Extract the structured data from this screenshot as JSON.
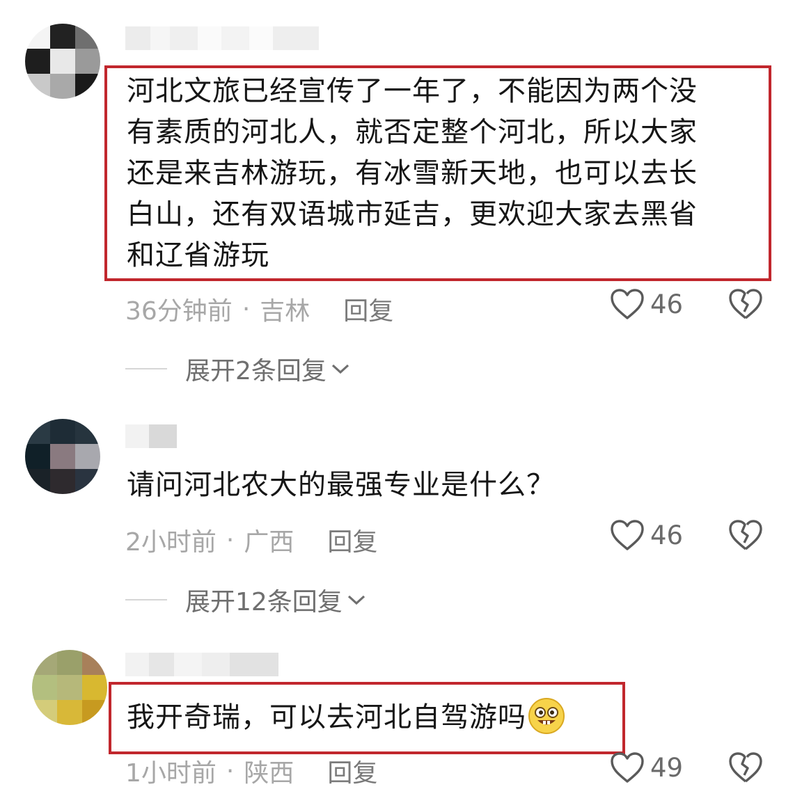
{
  "comments": [
    {
      "text": "河北文旅已经宣传了一年了，不能因为两个没有素质的河北人，就否定整个河北，所以大家还是来吉林游玩，有冰雪新天地，也可以去长白山，还有双语城市延吉，更欢迎大家去黑省和辽省游玩",
      "lines": [
        "河北文旅已经宣传了一年了，不能因为两个没",
        "有素质的河北人，就否定整个河北，所以大家",
        "还是来吉林游玩，有冰雪新天地，也可以去长",
        "白山，还有双语城市延吉，更欢迎大家去黑省",
        "和辽省游玩"
      ],
      "time": "36分钟前",
      "location": "吉林",
      "reply_label": "回复",
      "likes": "46",
      "expand": "展开2条回复",
      "highlighted": true
    },
    {
      "text": "请问河北农大的最强专业是什么？",
      "lines": [
        "请问河北农大的最强专业是什么？"
      ],
      "time": "2小时前",
      "location": "广西",
      "reply_label": "回复",
      "likes": "46",
      "expand": "展开12条回复",
      "highlighted": false
    },
    {
      "text": "我开奇瑞，可以去河北自驾游吗",
      "lines": [
        "我开奇瑞，可以去河北自驾游吗"
      ],
      "emoji": "grinning-emoji",
      "time": "1小时前",
      "location": "陕西",
      "reply_label": "回复",
      "likes": "49",
      "highlighted": true
    }
  ],
  "separator": "·",
  "colors": {
    "highlight_border": "#c1272d",
    "text": "#161616",
    "meta": "#a7a7a7"
  },
  "icons": {
    "like": "heart-outline-icon",
    "dislike": "broken-heart-icon",
    "expand": "chevron-down-icon"
  }
}
